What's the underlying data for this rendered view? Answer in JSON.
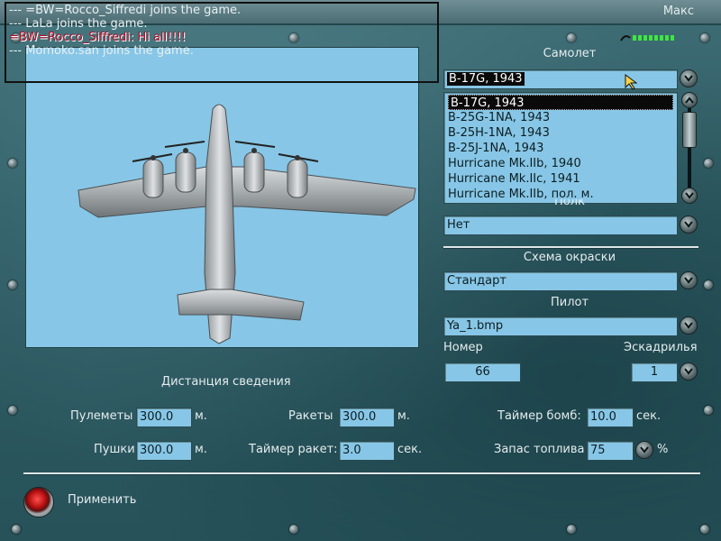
{
  "header": {
    "user": "Макс"
  },
  "chat": {
    "lines": [
      {
        "text": "--- =BW=Rocco_Siffredi joins the game."
      },
      {
        "text": "--- LaLa joins the game."
      },
      {
        "text": "=BW=Rocco_Siffredi: Hi all!!!!"
      },
      {
        "text": "--- Momoko.san joins the game."
      }
    ]
  },
  "aircraft": {
    "label": "Самолет",
    "selected": "B-17G, 1943",
    "options": [
      "B-17G, 1943",
      "B-25G-1NA, 1943",
      "B-25H-1NA, 1943",
      "B-25J-1NA, 1943",
      "Hurricane Mk.IIb, 1940",
      "Hurricane Mk.IIc, 1941",
      "Hurricane Mk.IIb, пол. м."
    ]
  },
  "weapons": {
    "label_partial": "Полк",
    "value": "Нет"
  },
  "paint": {
    "label": "Схема окраски",
    "value": "Стандарт"
  },
  "pilot": {
    "label": "Пилот",
    "value": "Ya_1.bmp"
  },
  "number": {
    "label": "Номер",
    "value": "66"
  },
  "squadron": {
    "label": "Эскадрилья",
    "value": "1"
  },
  "convergence": {
    "title": "Дистанция сведения",
    "machineguns": {
      "label": "Пулеметы",
      "value": "300.0",
      "unit": "м."
    },
    "cannons": {
      "label": "Пушки",
      "value": "300.0",
      "unit": "м."
    },
    "rockets": {
      "label": "Ракеты",
      "value": "300.0",
      "unit": "м."
    },
    "rocket_timer": {
      "label": "Таймер ракет:",
      "value": "3.0",
      "unit": "сек."
    },
    "bomb_timer": {
      "label": "Таймер бомб:",
      "value": "10.0",
      "unit": "сек."
    },
    "fuel": {
      "label": "Запас топлива",
      "value": "75",
      "unit": "%"
    }
  },
  "apply": {
    "label": "Применить"
  },
  "colors": {
    "field_bg": "#87c6e6",
    "signal_green": "#3fe63f",
    "chat_red": "#b0102a"
  }
}
